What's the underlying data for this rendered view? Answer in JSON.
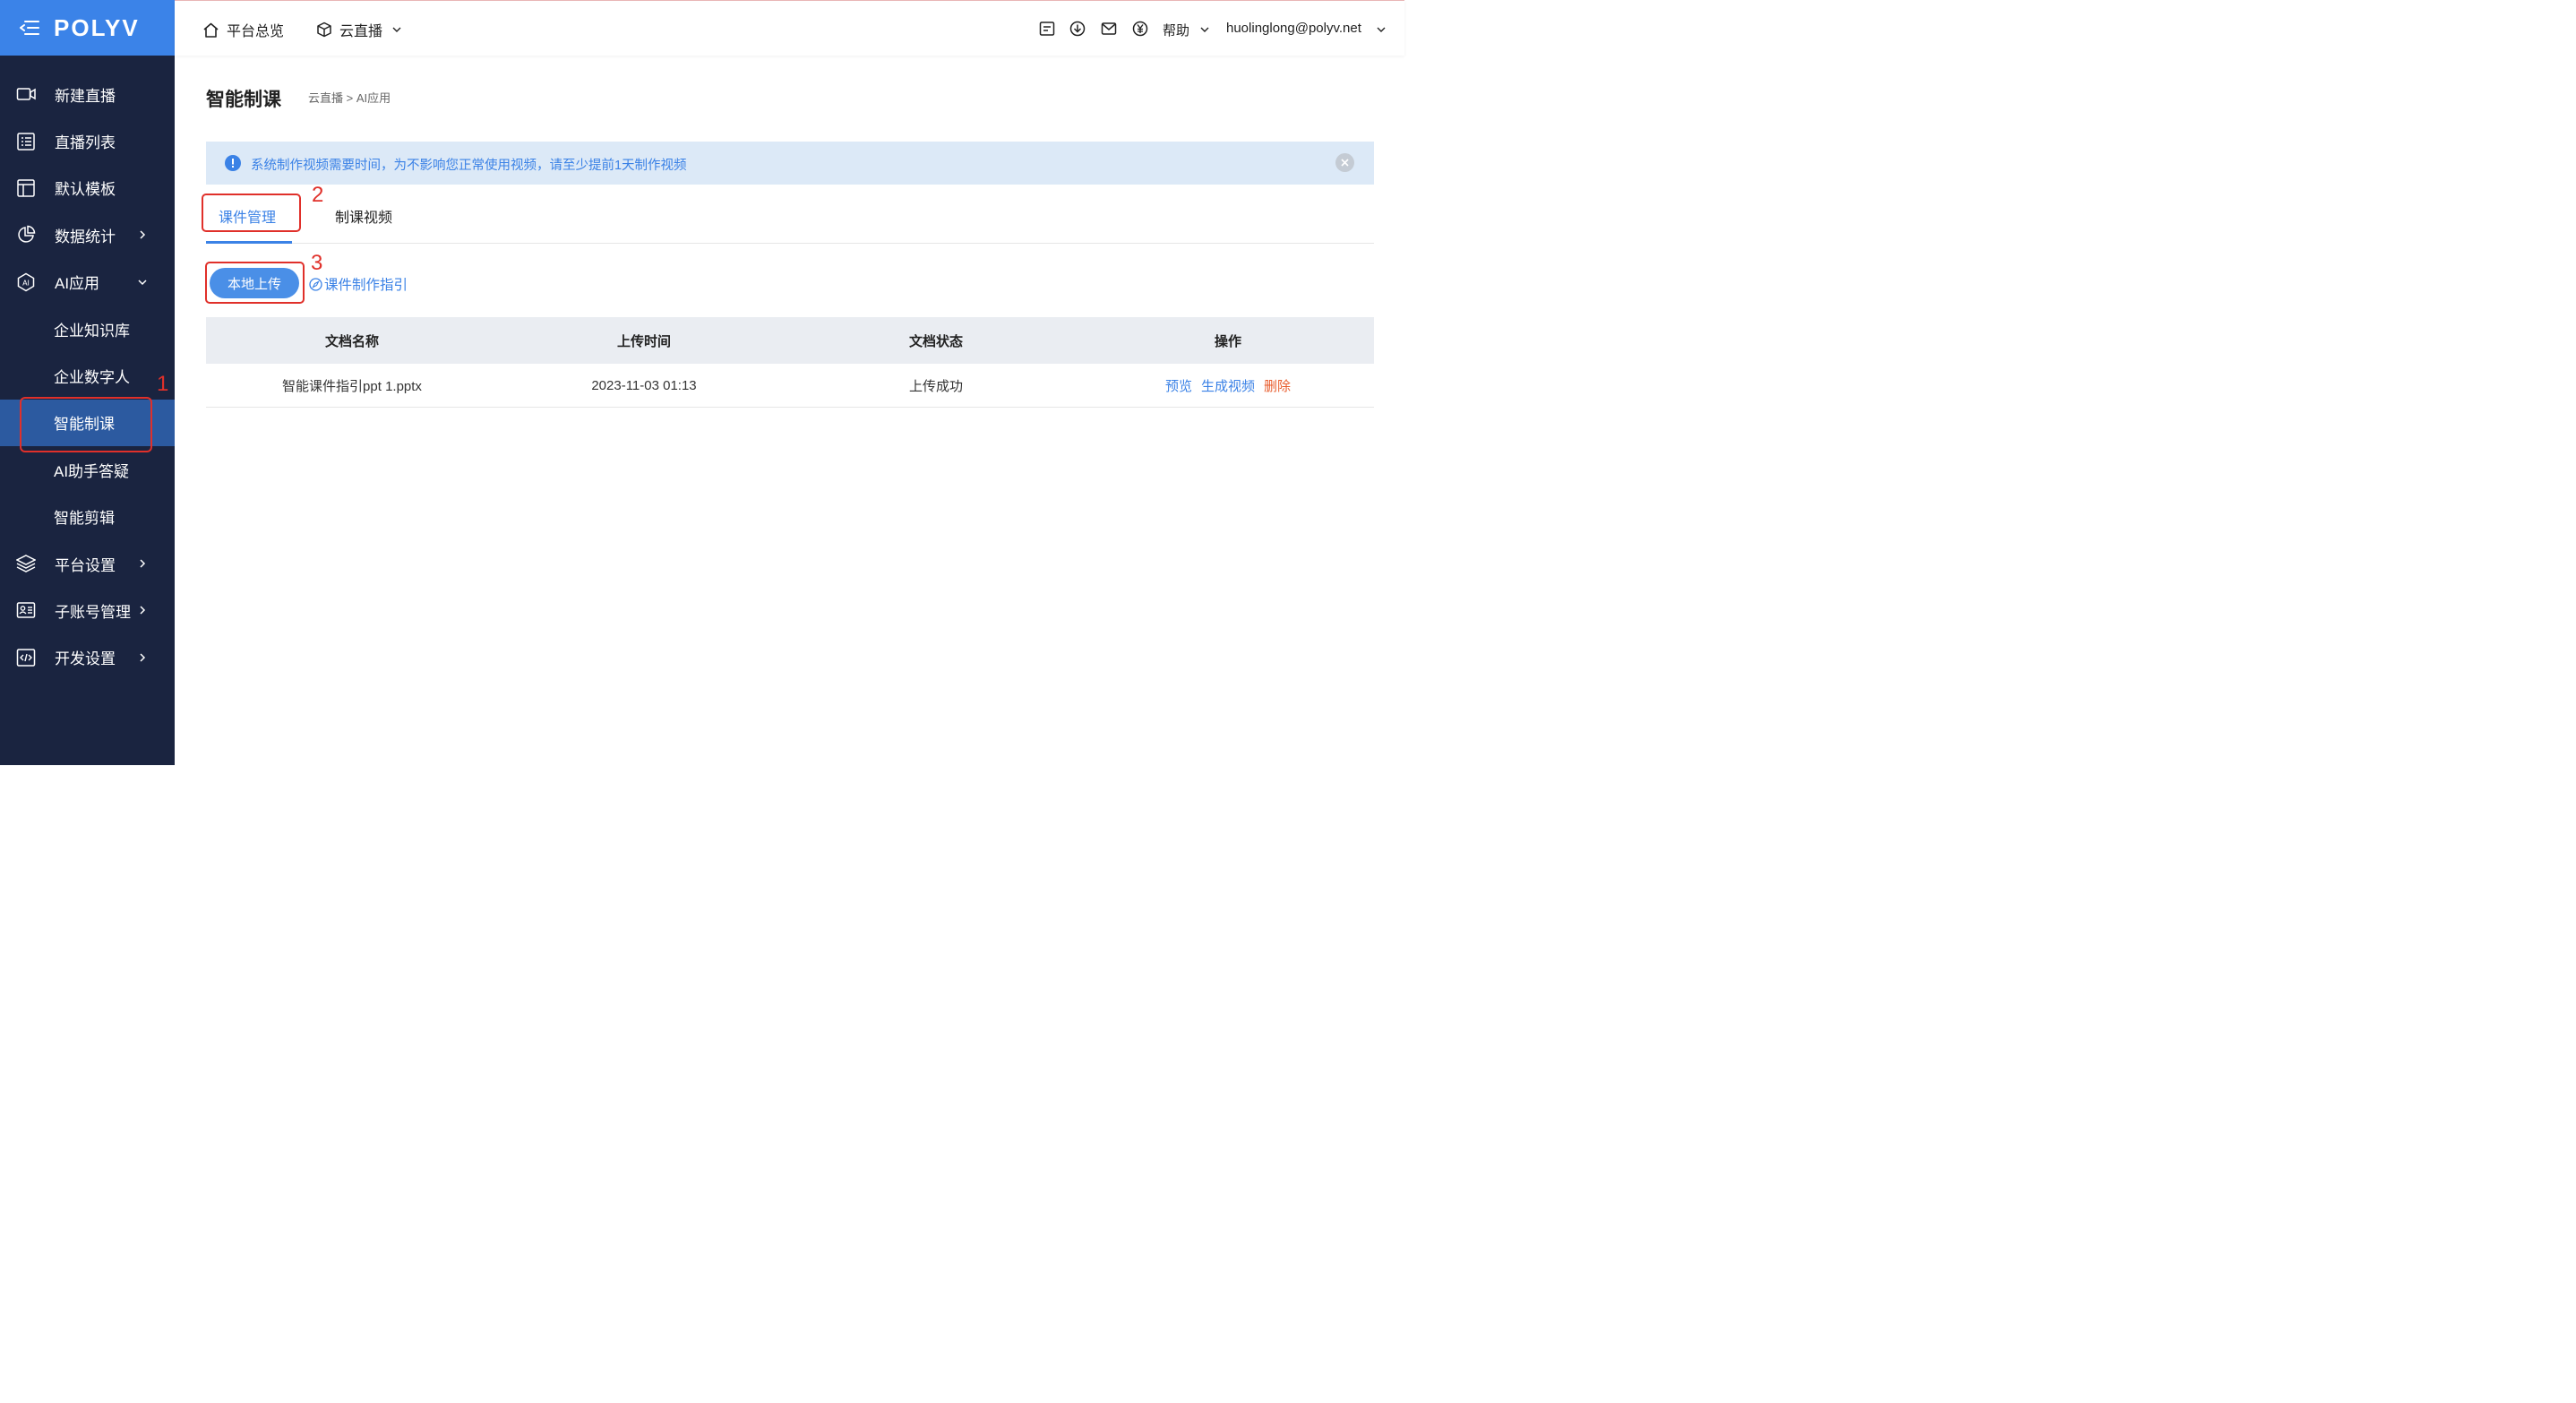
{
  "brand": {
    "logo": "POLYV",
    "accent": "#3b83e8",
    "sidebar_bg": "#1a2440"
  },
  "sidebar": {
    "items": [
      {
        "label": "新建直播",
        "icon": "video-icon"
      },
      {
        "label": "直播列表",
        "icon": "list-icon"
      },
      {
        "label": "默认模板",
        "icon": "template-icon"
      },
      {
        "label": "数据统计",
        "icon": "pie-chart-icon"
      },
      {
        "label": "AI应用",
        "icon": "ai-hexagon-icon"
      },
      {
        "label": "企业知识库"
      },
      {
        "label": "企业数字人"
      },
      {
        "label": "智能制课",
        "active": true
      },
      {
        "label": "AI助手答疑"
      },
      {
        "label": "智能剪辑"
      },
      {
        "label": "平台设置",
        "icon": "layers-icon"
      },
      {
        "label": "子账号管理",
        "icon": "id-card-icon"
      },
      {
        "label": "开发设置",
        "icon": "code-icon"
      }
    ]
  },
  "topbar": {
    "overview": "平台总览",
    "product": "云直播",
    "help": "帮助",
    "user_email": "huolinglong@polyv.net",
    "icons": [
      "document-icon",
      "download-icon",
      "mail-icon",
      "yen-icon"
    ]
  },
  "page": {
    "title": "智能制课",
    "breadcrumb": "云直播 > AI应用"
  },
  "alert": {
    "text": "系统制作视频需要时间，为不影响您正常使用视频，请至少提前1天制作视频"
  },
  "tabs": [
    {
      "label": "课件管理",
      "active": true
    },
    {
      "label": "制课视频",
      "active": false
    }
  ],
  "toolbar": {
    "upload_label": "本地上传",
    "guide_label": "课件制作指引"
  },
  "table": {
    "headers": [
      "文档名称",
      "上传时间",
      "文档状态",
      "操作"
    ],
    "rows": [
      {
        "name": "智能课件指引ppt 1.pptx",
        "time": "2023-11-03 01:13",
        "status": "上传成功",
        "actions": [
          "预览",
          "生成视频",
          "删除"
        ]
      }
    ]
  },
  "annotations": [
    "1",
    "2",
    "3"
  ]
}
